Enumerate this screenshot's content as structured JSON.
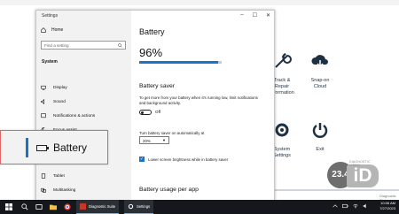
{
  "desktop": {
    "tiles": {
      "track_repair": "Track &\nRepair\nInformation",
      "snapon_cloud": "Snap-on\nCloud",
      "system_settings": "System\nSettings",
      "exit": "Exit"
    },
    "footer": "Diagnostic Status"
  },
  "badge": {
    "number": "23.4",
    "logo_letters": "iD",
    "logo_caption": "DIAGNOSTIC VIDEO"
  },
  "settings": {
    "window_title": "Settings",
    "sidebar": {
      "home": "Home",
      "search_placeholder": "Find a setting",
      "section": "System",
      "items": [
        "Display",
        "Sound",
        "Notifications & actions",
        "Focus assist",
        "Tablet",
        "Multitasking"
      ]
    },
    "main": {
      "title": "Battery",
      "percent": "96%",
      "level": 0.96,
      "saver_heading": "Battery saver",
      "saver_desc": "To get more from your battery when it's running low, limit notifications and background activity.",
      "toggle_state": "Off",
      "auto_label": "Turn battery saver on automatically at",
      "auto_value": "20%",
      "checkbox_label": "Lower screen brightness while in battery saver",
      "checkbox_checked": true,
      "usage_heading": "Battery usage per app"
    }
  },
  "callout": {
    "label": "Battery"
  },
  "taskbar": {
    "apps": [
      "Diagnostic Suite",
      "Settings"
    ],
    "time": "10:06 AM",
    "date": "7/27/2023"
  },
  "colors": {
    "accent": "#1a73c8",
    "callout_border": "#e06565",
    "taskbar": "#14181d"
  }
}
